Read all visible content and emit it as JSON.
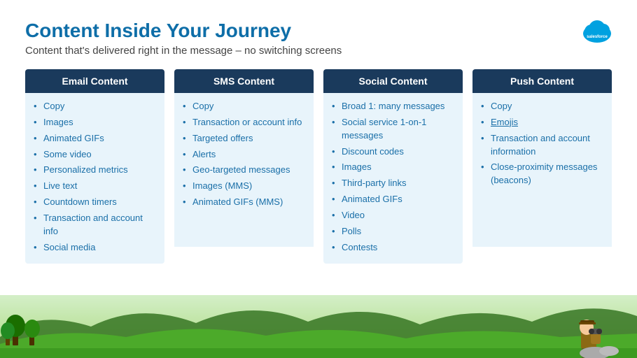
{
  "slide": {
    "title": "Content Inside Your Journey",
    "subtitle": "Content that's delivered right in the message – no switching screens"
  },
  "logo": {
    "text": "salesforce",
    "color": "#00a1e0"
  },
  "columns": [
    {
      "id": "email",
      "header": "Email Content",
      "items": [
        "Copy",
        "Images",
        "Animated GIFs",
        "Some video",
        "Personalized metrics",
        "Live text",
        "Countdown timers",
        "Transaction and account info",
        "Social media"
      ]
    },
    {
      "id": "sms",
      "header": "SMS Content",
      "items": [
        "Copy",
        "Transaction or account info",
        "Targeted offers",
        "Alerts",
        "Geo-targeted messages",
        "Images (MMS)",
        "Animated GIFs (MMS)"
      ]
    },
    {
      "id": "social",
      "header": "Social Content",
      "items": [
        "Broad 1: many messages",
        "Social service 1-on-1 messages",
        "Discount codes",
        "Images",
        "Third-party links",
        "Animated GIFs",
        "Video",
        "Polls",
        "Contests"
      ]
    },
    {
      "id": "push",
      "header": "Push Content",
      "items": [
        "Copy",
        "Emojis",
        "Transaction and account information",
        "Close-proximity messages (beacons)"
      ]
    }
  ]
}
